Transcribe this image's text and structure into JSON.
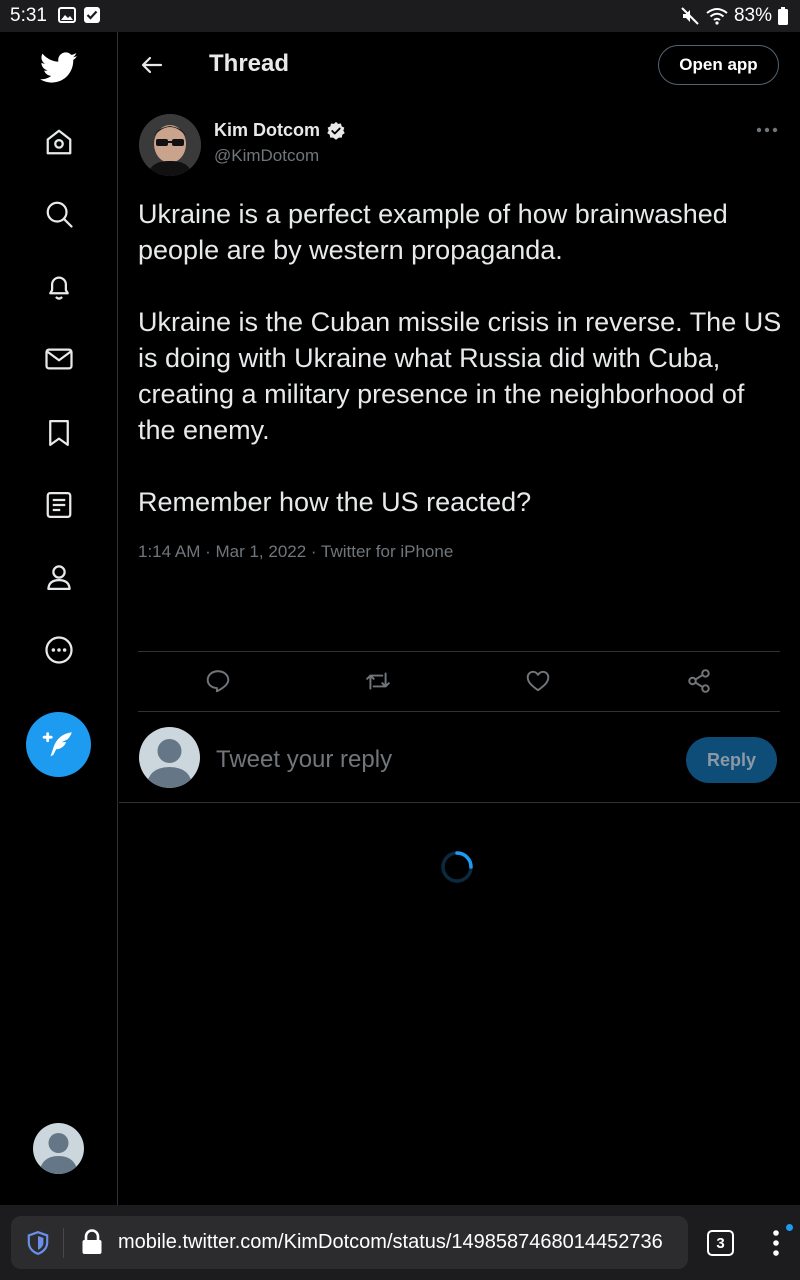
{
  "status_bar": {
    "time": "5:31",
    "battery": "83%"
  },
  "header": {
    "title": "Thread",
    "open_app_label": "Open app"
  },
  "tweet": {
    "author_name": "Kim Dotcom",
    "author_handle": "@KimDotcom",
    "verified": true,
    "paragraphs": [
      "Ukraine is a perfect example of how brainwashed people are by western propaganda.",
      "Ukraine is the Cuban missile crisis in reverse. The US is doing with Ukraine what Russia did with Cuba, creating a military presence in the neighborhood of the enemy.",
      "Remember how the US reacted?"
    ],
    "meta": "1:14 AM · Mar 1, 2022 · Twitter for iPhone"
  },
  "reply": {
    "placeholder": "Tweet your reply",
    "button_label": "Reply"
  },
  "browser": {
    "url": "mobile.twitter.com/KimDotcom/status/1498587468014452736",
    "tab_count": "3"
  },
  "nav": {
    "items": [
      "home-icon",
      "search-icon",
      "bell-icon",
      "mail-icon",
      "bookmark-icon",
      "list-icon",
      "profile-icon",
      "more-circle-icon"
    ]
  },
  "colors": {
    "accent": "#1d9bf0",
    "background": "#000000",
    "secondary_text": "#71767b",
    "reply_button_bg": "#0e4d78"
  }
}
